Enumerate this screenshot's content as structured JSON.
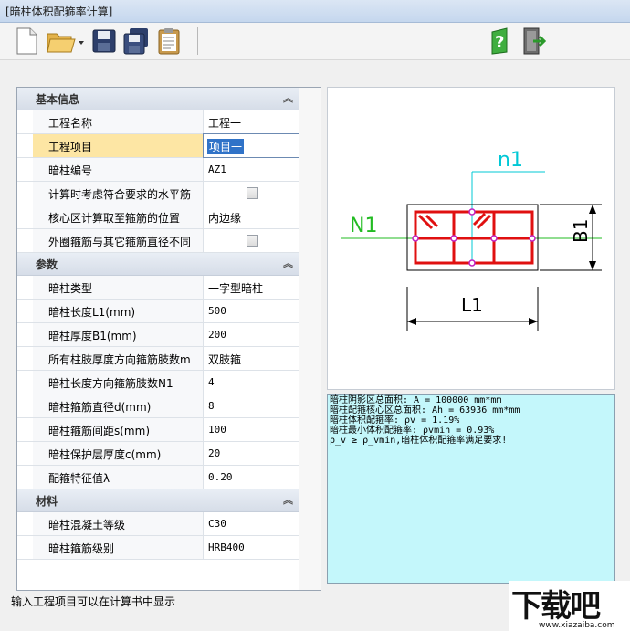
{
  "window": {
    "title": "[暗柱体积配箍率计算]"
  },
  "toolbar": {
    "icons": [
      "new-file-icon",
      "open-folder-icon",
      "save-icon",
      "save-as-icon",
      "clipboard-icon",
      "help-icon",
      "exit-icon"
    ]
  },
  "property_grid": {
    "categories": [
      {
        "label": "基本信息"
      },
      {
        "label": "参数"
      },
      {
        "label": "材料"
      }
    ],
    "basic": [
      {
        "label": "工程名称",
        "value": "工程一"
      },
      {
        "label": "工程项目",
        "value": "项目一"
      },
      {
        "label": "暗柱编号",
        "value": "AZ1"
      },
      {
        "label": "计算时考虑符合要求的水平筋",
        "value": ""
      },
      {
        "label": "核心区计算取至箍筋的位置",
        "value": "内边缘"
      },
      {
        "label": "外圈箍筋与其它箍筋直径不同",
        "value": ""
      }
    ],
    "params": [
      {
        "label": "暗柱类型",
        "value": "一字型暗柱"
      },
      {
        "label": "暗柱长度L1(mm)",
        "value": "500"
      },
      {
        "label": "暗柱厚度B1(mm)",
        "value": "200"
      },
      {
        "label": "所有柱肢厚度方向箍筋肢数m",
        "value": "双肢箍"
      },
      {
        "label": "暗柱长度方向箍筋肢数N1",
        "value": "4"
      },
      {
        "label": "暗柱箍筋直径d(mm)",
        "value": "8"
      },
      {
        "label": "暗柱箍筋间距s(mm)",
        "value": "100"
      },
      {
        "label": "暗柱保护层厚度c(mm)",
        "value": "20"
      },
      {
        "label": "配箍特征值λ",
        "value": "0.20"
      }
    ],
    "materials": [
      {
        "label": "暗柱混凝土等级",
        "value": "C30"
      },
      {
        "label": "暗柱箍筋级别",
        "value": "HRB400"
      }
    ]
  },
  "diagram": {
    "label_n1": "n1",
    "label_N1": "N1",
    "label_B1": "B1",
    "label_L1": "L1"
  },
  "result": {
    "lines": [
      "暗柱阴影区总面积: A = 100000 mm*mm",
      "暗柱配箍核心区总面积: Ah = 63936 mm*mm",
      "暗柱体积配箍率: ρv = 1.19%",
      "暗柱最小体积配箍率: ρvmin = 0.93%",
      "ρ_v ≥ ρ_vmin,暗柱体积配箍率满足要求!"
    ]
  },
  "status": {
    "text": "输入工程项目可以在计算书中显示"
  },
  "watermark": {
    "text": "下载吧",
    "url": "www.xiazaiba.com"
  }
}
